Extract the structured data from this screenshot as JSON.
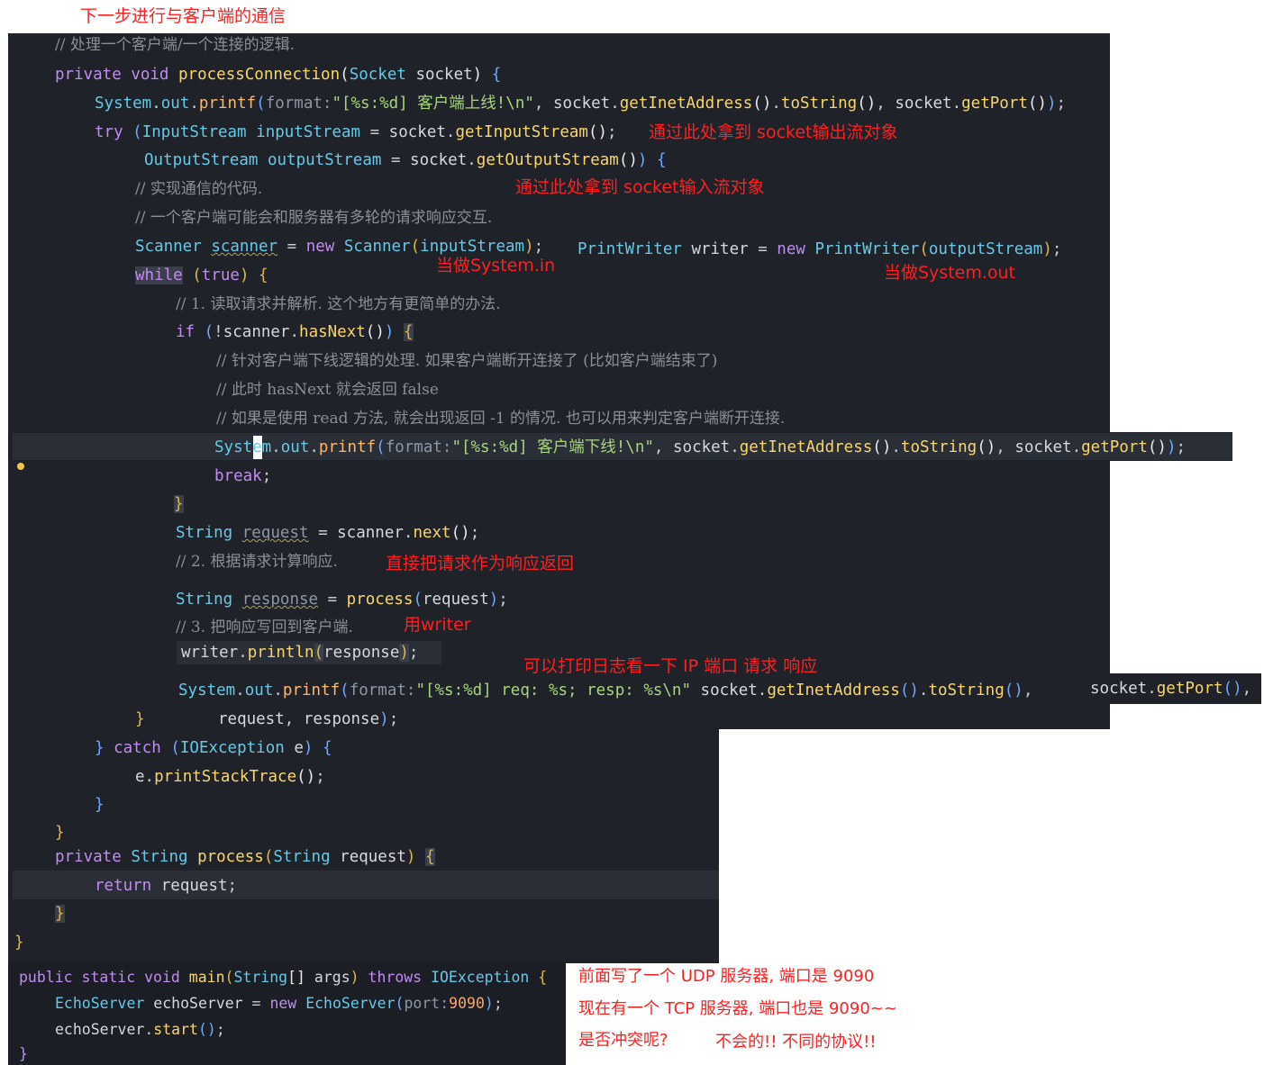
{
  "annotations": {
    "top_title": "下一步进行与客户端的通信",
    "socket_output": "通过此处拿到 socket输出流对象",
    "socket_input": "通过此处拿到 socket输入流对象",
    "as_system_in": "当做System.in",
    "as_system_out": "当做System.out",
    "echo": "直接把请求作为响应返回",
    "use_writer": "用writer",
    "log": "可以打印日志看一下    IP  端口  请求 响应",
    "udp_note": "前面写了一个 UDP 服务器, 端口是 9090",
    "tcp_note": "现在有一个 TCP 服务器, 端口也是 9090~~",
    "conflict_q": "是否冲突呢?",
    "conflict_a": "不会的!! 不同的协议!!"
  },
  "code": {
    "c_logic": "// 处理一个客户端/一个连接的逻辑.",
    "kw_private": "private",
    "kw_void": "void",
    "fn_processConnection": "processConnection",
    "ty_Socket": "Socket",
    "v_socket": "socket",
    "System": "System",
    "out": "out",
    "printf": "printf",
    "hint_format": "format:",
    "str_online": "\"[%s:%d] 客户端上线!\\n\"",
    "getInetAddress": "getInetAddress",
    "toString": "toString",
    "getPort": "getPort",
    "kw_try": "try",
    "ty_InputStream": "InputStream",
    "v_inputStream": "inputStream",
    "getInputStream": "getInputStream",
    "ty_OutputStream": "OutputStream",
    "v_outputStream": "outputStream",
    "getOutputStream": "getOutputStream",
    "c_impl": "// 实现通信的代码.",
    "c_multi": "// 一个客户端可能会和服务器有多轮的请求响应交互.",
    "ty_Scanner": "Scanner",
    "v_scanner": "scanner",
    "kw_new": "new",
    "ty_PrintWriter": "PrintWriter",
    "v_writer": "writer",
    "kw_while": "while",
    "kw_true": "true",
    "c_step1": "// 1. 读取请求并解析. 这个地方有更简单的办法.",
    "kw_if": "if",
    "hasNext": "hasNext",
    "c_offline": "// 针对客户端下线逻辑的处理. 如果客户端断开连接了 (比如客户端结束了)",
    "c_hasnext": "// 此时 hasNext 就会返回 false",
    "c_read": "// 如果是使用 read 方法, 就会出现返回 -1 的情况. 也可以用来判定客户端断开连接.",
    "str_offline": "\"[%s:%d] 客户端下线!\\n\"",
    "kw_break": "break",
    "ty_String": "String",
    "v_request": "request",
    "next": "next",
    "c_step2": "// 2. 根据请求计算响应.",
    "v_response": "response",
    "fn_process": "process",
    "c_step3": "// 3. 把响应写回到客户端.",
    "println": "println",
    "str_log": "\"[%s:%d] req: %s; resp: %s\\n\"",
    "kw_catch": "catch",
    "ty_IOException": "IOException",
    "v_e": "e",
    "printStackTrace": "printStackTrace",
    "kw_return": "return",
    "kw_public": "public",
    "kw_static": "static",
    "fn_main": "main",
    "v_args": "args",
    "kw_throws": "throws",
    "ty_EchoServer": "EchoServer",
    "v_echoServer": "echoServer",
    "hint_port": "port:",
    "num_port": "9090",
    "start": "start"
  }
}
